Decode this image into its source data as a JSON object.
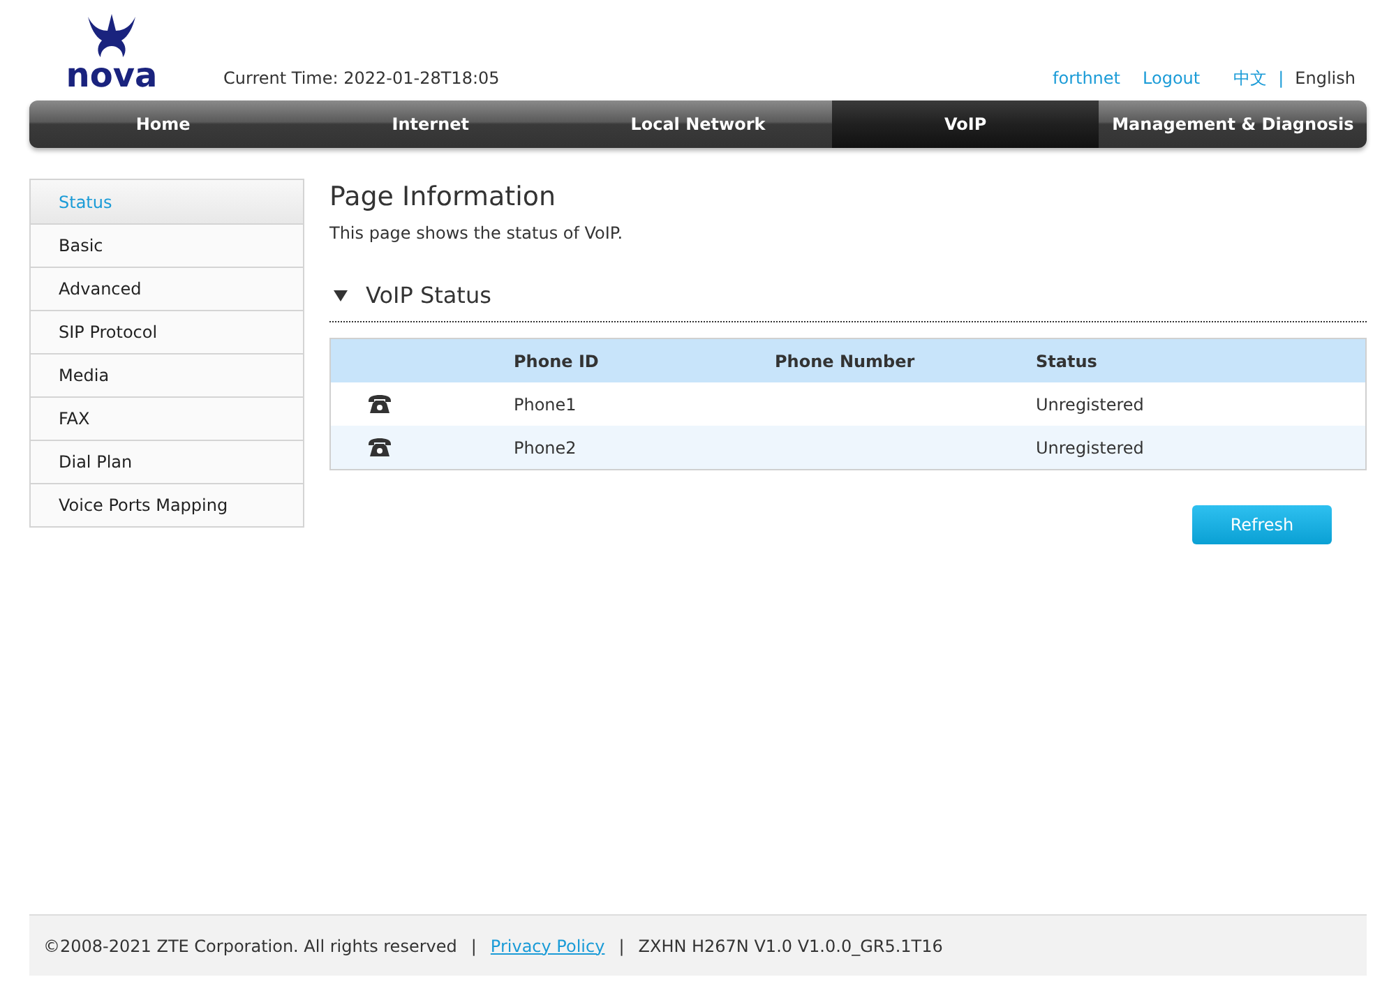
{
  "header": {
    "logo_text": "nova",
    "current_time": "Current Time: 2022-01-28T18:05",
    "user": "forthnet",
    "logout": "Logout",
    "languages": [
      {
        "label": "中文",
        "selected": false
      },
      {
        "label": "English",
        "selected": true
      }
    ],
    "language_separator": "|"
  },
  "nav": [
    {
      "label": "Home",
      "selected": false
    },
    {
      "label": "Internet",
      "selected": false
    },
    {
      "label": "Local Network",
      "selected": false
    },
    {
      "label": "VoIP",
      "selected": true
    },
    {
      "label": "Management & Diagnosis",
      "selected": false
    }
  ],
  "sidebar": {
    "items": [
      {
        "label": "Status",
        "selected": true
      },
      {
        "label": "Basic",
        "selected": false
      },
      {
        "label": "Advanced",
        "selected": false
      },
      {
        "label": "SIP Protocol",
        "selected": false
      },
      {
        "label": "Media",
        "selected": false
      },
      {
        "label": "FAX",
        "selected": false
      },
      {
        "label": "Dial Plan",
        "selected": false
      },
      {
        "label": "Voice Ports Mapping",
        "selected": false
      }
    ]
  },
  "page": {
    "title": "Page Information",
    "description": "This page shows the status of VoIP.",
    "section": {
      "title": "VoIP Status",
      "expanded": true
    },
    "table": {
      "columns": [
        "Phone ID",
        "Phone Number",
        "Status"
      ],
      "rows": [
        {
          "phone_id": "Phone1",
          "status": "Unregistered"
        },
        {
          "phone_id": "Phone2",
          "status": "Unregistered"
        }
      ]
    },
    "refresh_button": "Refresh"
  },
  "footer": {
    "copyright": "©2008-2021 ZTE Corporation. All rights reserved",
    "separator_1": "|",
    "privacy_link": "Privacy Policy",
    "separator_2": "|",
    "version": "ZXHN H267N V1.0 V1.0.0_GR5.1T16"
  }
}
